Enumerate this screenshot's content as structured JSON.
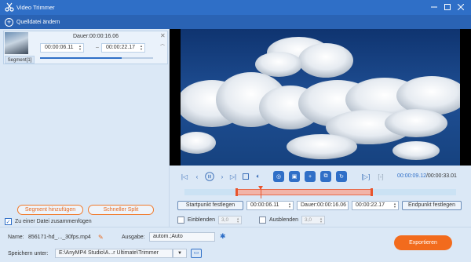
{
  "window": {
    "title": "Video Trimmer",
    "accent": "#2f6fc7",
    "export_color": "#f26b1d"
  },
  "toolbar": {
    "add_source_label": "Quelldatei ändern"
  },
  "segment": {
    "label": "Segment[1]",
    "duration": "Dauer:00:00:16.06",
    "start": "00:00:06.11",
    "end": "00:00:22.17",
    "progress": 0.72
  },
  "left_actions": {
    "add_segment": "Segment hinzufügen",
    "quick_split": "Schneller Split",
    "merge_label": "Zu einer Datei zusammenfügen",
    "merge_checked": true
  },
  "player": {
    "current_time": "00:00:09.12",
    "total_time": "/00:00:33.01",
    "selection_start": 0.19,
    "selection_end": 0.69,
    "playhead": 0.28
  },
  "trim": {
    "set_start": "Startpunkt festlegen",
    "start_value": "00:00:06.11",
    "duration_value": "Dauer:00:00:16.06",
    "end_value": "00:00:22.17",
    "set_end": "Endpunkt festlegen"
  },
  "fade": {
    "fade_in_label": "Einblenden",
    "fade_in_value": "3,0",
    "fade_out_label": "Ausblenden",
    "fade_out_value": "3,0"
  },
  "output": {
    "name_label": "Name:",
    "name_value": "856171-hd_..._30fps.mp4",
    "output_label": "Ausgabe:",
    "output_value": "autom.;Auto",
    "save_label": "Speichern unter:",
    "save_path": "E:\\AnyMP4 Studio\\A...r Ultimate\\Trimmer",
    "export_label": "Exportieren"
  }
}
